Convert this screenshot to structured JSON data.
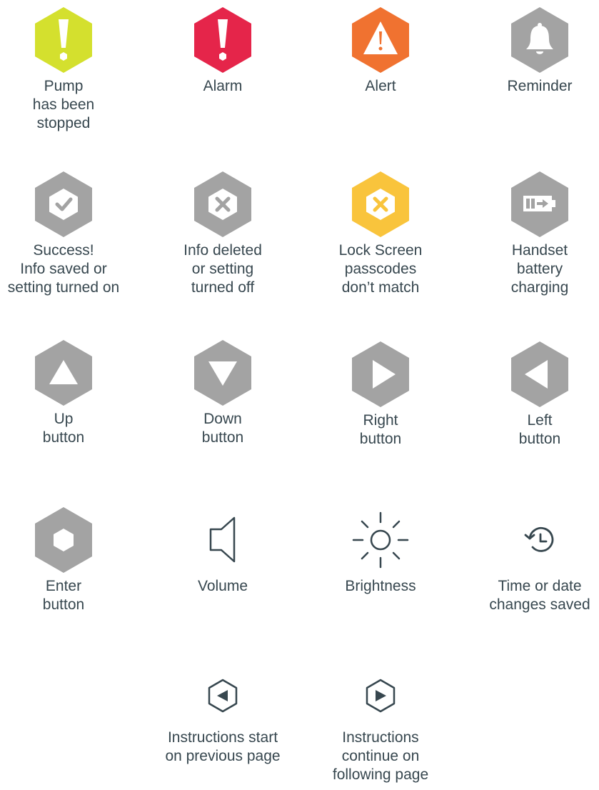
{
  "icons": {
    "pump_stopped": {
      "label": "Pump\nhas been\nstopped",
      "icon": "exclamation-icon",
      "color": "#d4e02e"
    },
    "alarm": {
      "label": "Alarm",
      "icon": "exclamation-icon",
      "color": "#e5254a"
    },
    "alert": {
      "label": "Alert",
      "icon": "warning-triangle-icon",
      "color": "#f07230"
    },
    "reminder": {
      "label": "Reminder",
      "icon": "bell-icon",
      "color": "#a3a3a3"
    },
    "success": {
      "label": "Success!\nInfo saved or\nsetting turned on",
      "icon": "check-icon",
      "color": "#a3a3a3"
    },
    "info_deleted": {
      "label": "Info deleted\nor setting\nturned off",
      "icon": "x-icon",
      "color": "#a3a3a3"
    },
    "lock_mismatch": {
      "label": "Lock Screen\npasscodes\ndon’t match",
      "icon": "x-icon",
      "color": "#f9c43c"
    },
    "battery_charging": {
      "label": "Handset\nbattery\ncharging",
      "icon": "battery-charging-icon",
      "color": "#a3a3a3"
    },
    "up": {
      "label": "Up\nbutton",
      "icon": "up-triangle-icon",
      "color": "#a3a3a3"
    },
    "down": {
      "label": "Down\nbutton",
      "icon": "down-triangle-icon",
      "color": "#a3a3a3"
    },
    "right": {
      "label": "Right\nbutton",
      "icon": "right-triangle-icon",
      "color": "#a3a3a3"
    },
    "left": {
      "label": "Left\nbutton",
      "icon": "left-triangle-icon",
      "color": "#a3a3a3"
    },
    "enter": {
      "label": "Enter\nbutton",
      "icon": "hexagon-icon",
      "color": "#a3a3a3"
    },
    "volume": {
      "label": "Volume",
      "icon": "speaker-icon",
      "color": "#37474f"
    },
    "brightness": {
      "label": "Brightness",
      "icon": "sun-icon",
      "color": "#37474f"
    },
    "time_saved": {
      "label": "Time or date\nchanges saved",
      "icon": "history-clock-icon",
      "color": "#37474f"
    },
    "prev_page": {
      "label": "Instructions start\non previous page",
      "icon": "prev-page-icon",
      "color": "#37474f"
    },
    "next_page": {
      "label": "Instructions\ncontinue on\nfollowing page",
      "icon": "next-page-icon",
      "color": "#37474f"
    }
  }
}
